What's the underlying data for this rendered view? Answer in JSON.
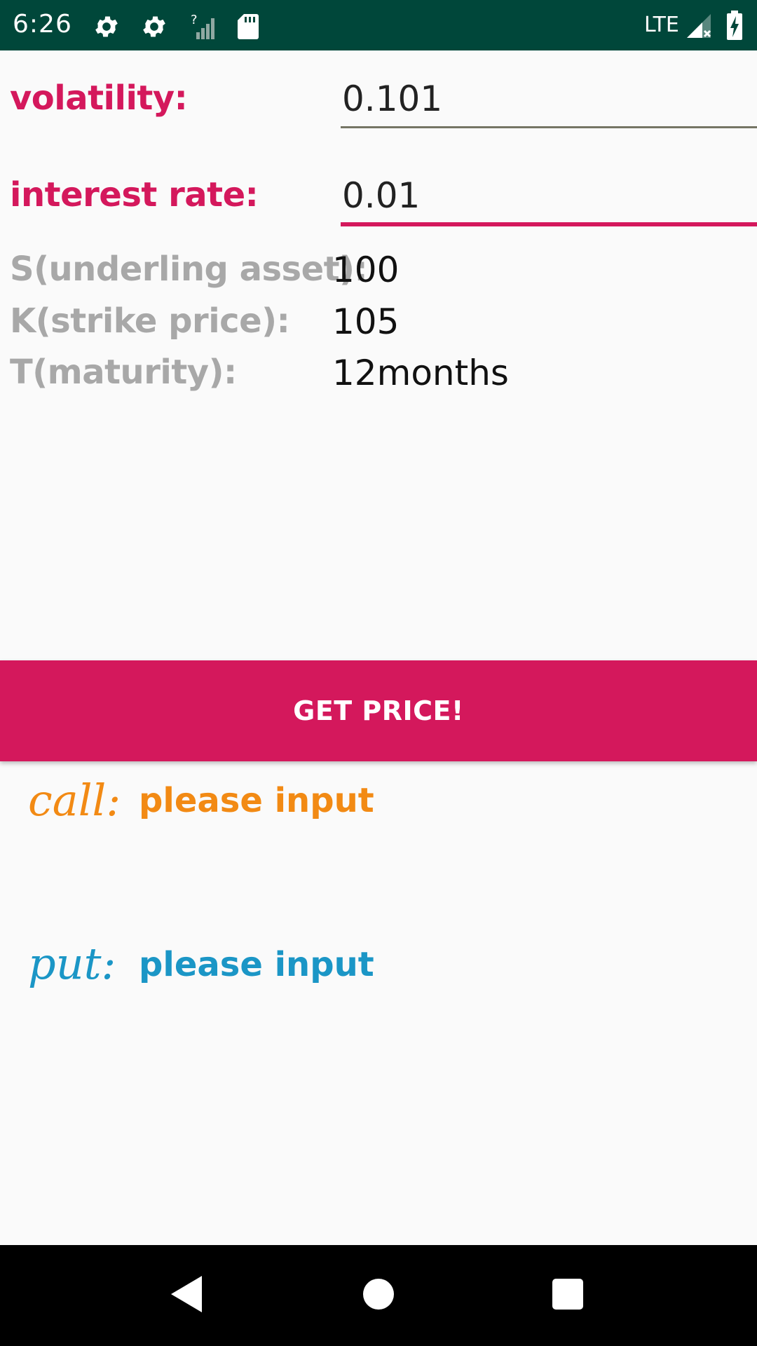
{
  "status_bar": {
    "time": "6:26",
    "network": "LTE",
    "signal_unknown": "?",
    "icons": [
      "gear-icon",
      "gear-icon",
      "signal-unknown-icon",
      "sd-card-icon",
      "cell-signal-icon",
      "battery-charging-icon"
    ],
    "background": "#00473a"
  },
  "form": {
    "volatility": {
      "label": "volatility:",
      "value": "0.101"
    },
    "interest_rate": {
      "label": "interest rate:",
      "value": "0.01"
    }
  },
  "params": [
    {
      "label": "S(underling asset):",
      "value": "100"
    },
    {
      "label": "K(strike price):",
      "value": "105"
    },
    {
      "label": "T(maturity):",
      "value": "12months"
    }
  ],
  "button": {
    "label": "GET PRICE!",
    "color": "#d4185c"
  },
  "results": {
    "call": {
      "label": "call:",
      "value": "please input",
      "color": "#f28a14"
    },
    "put": {
      "label": "put:",
      "value": "please input",
      "color": "#1b96c6"
    }
  },
  "nav_bar": {
    "icons": [
      "back-icon",
      "home-icon",
      "recents-icon"
    ]
  },
  "colors": {
    "accent": "#d4185c",
    "muted_label": "#a8a8a8"
  }
}
